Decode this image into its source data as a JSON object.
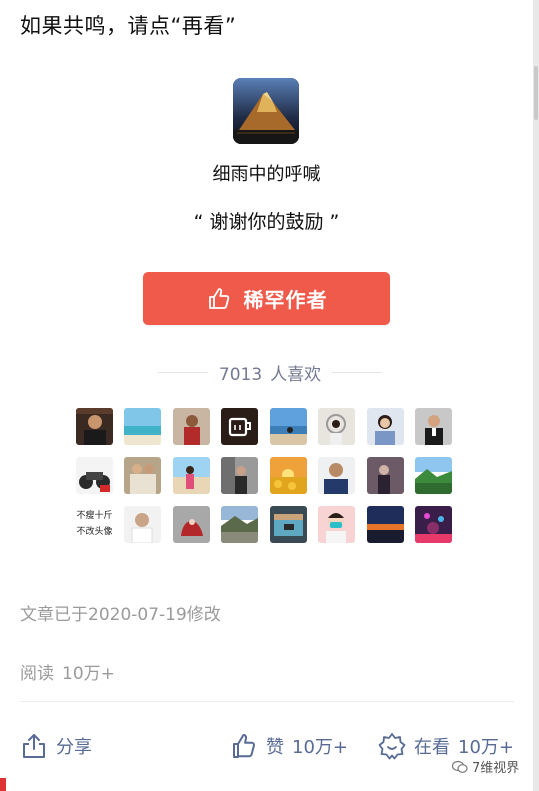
{
  "header": {
    "text": "如果共鸣，请点“再看”"
  },
  "author": {
    "name": "细雨中的呼喊",
    "quote": "“ 谢谢你的鼓励 ”"
  },
  "reward_button": {
    "label": "稀罕作者",
    "icon": "thumbs-up-icon"
  },
  "likes": {
    "count": "7013",
    "suffix": "人喜欢"
  },
  "avatar_text": {
    "line1": "不瘦十斤",
    "line2": "不改头像"
  },
  "footer_info": {
    "modified": "文章已于2020-07-19修改",
    "reads_label": "阅读",
    "reads_value": "10万+"
  },
  "actions": {
    "share": {
      "label": "分享",
      "icon": "share-icon"
    },
    "like": {
      "label": "赞",
      "count": "10万+",
      "icon": "like-icon"
    },
    "look": {
      "label": "在看",
      "count": "10万+",
      "icon": "wow-icon"
    }
  },
  "watermark": {
    "text": "7维视界",
    "icon": "wechat-icon"
  },
  "colors": {
    "accent": "#f05a4a",
    "link": "#576b95",
    "muted": "#9a9a9a"
  }
}
